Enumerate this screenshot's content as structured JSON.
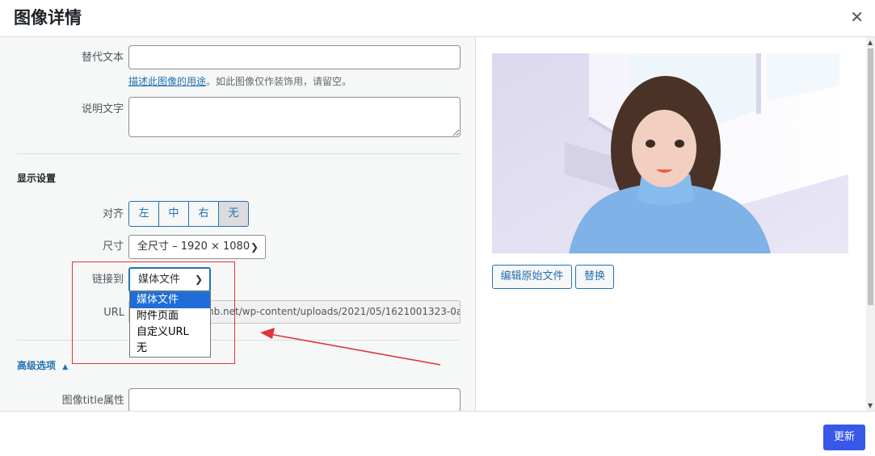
{
  "header": {
    "title": "图像详情",
    "close_glyph": "✕"
  },
  "fields": {
    "alt_label": "替代文本",
    "alt_value": "",
    "alt_hint_link": "描述此图像的用途",
    "alt_hint_rest": "。如此图像仅作装饰用，请留空。",
    "caption_label": "说明文字",
    "caption_value": ""
  },
  "display": {
    "section_title": "显示设置",
    "align_label": "对齐",
    "align_options": [
      "左",
      "中",
      "右",
      "无"
    ],
    "align_selected": "无",
    "size_label": "尺寸",
    "size_value": "全尺寸 – 1920 × 1080",
    "link_label": "链接到",
    "link_value": "媒体文件",
    "link_options": [
      "媒体文件",
      "附件页面",
      "自定义URL",
      "无"
    ],
    "url_label": "URL",
    "url_value": "nb.net/wp-content/uploads/2021/05/1621001323-0a"
  },
  "advanced": {
    "toggle_label": "高级选项",
    "toggle_glyph": "▲",
    "title_attr_label": "图像title属性",
    "title_attr_value": ""
  },
  "image_panel": {
    "edit_original_label": "编辑原始文件",
    "replace_label": "替换"
  },
  "footer": {
    "update_label": "更新"
  },
  "colors": {
    "primary_button": "#3858e9",
    "link_blue": "#2271b1",
    "annotation_red": "#e0353a",
    "dropdown_highlight": "#1e6dd8"
  }
}
